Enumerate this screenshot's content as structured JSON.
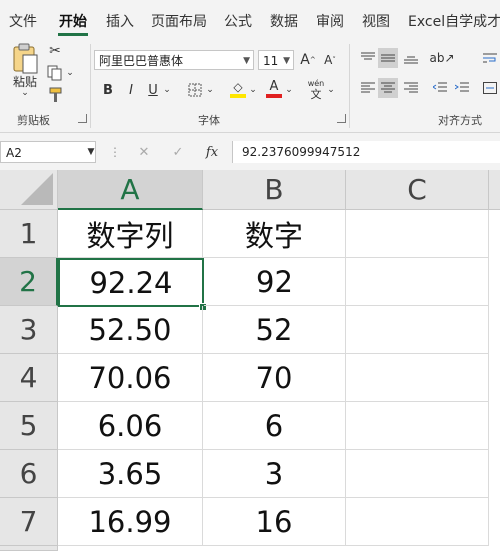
{
  "ribbon_tabs": [
    "文件",
    "开始",
    "插入",
    "页面布局",
    "公式",
    "数据",
    "审阅",
    "视图",
    "Excel自学成才"
  ],
  "active_tab": "开始",
  "clipboard": {
    "paste_label": "粘贴",
    "group_label": "剪贴板"
  },
  "font": {
    "family": "阿里巴巴普惠体",
    "size": "11",
    "group_label": "字体",
    "bold": "B",
    "italic": "I",
    "underline": "U",
    "grow": "A",
    "shrink": "A",
    "font_color_letter": "A",
    "phonetic_top": "wén",
    "phonetic_bottom": "文"
  },
  "alignment": {
    "group_label": "对齐方式"
  },
  "formula_bar": {
    "name_box": "A2",
    "cancel": "✕",
    "enter": "✓",
    "fx": "fx",
    "value": "92.2376099947512"
  },
  "sheet": {
    "columns": [
      "A",
      "B",
      "C"
    ],
    "selected_column": "A",
    "selected_row": "2",
    "rows": [
      {
        "num": "1",
        "a": "数字列",
        "b": "数字"
      },
      {
        "num": "2",
        "a": "92.24",
        "b": "92"
      },
      {
        "num": "3",
        "a": "52.50",
        "b": "52"
      },
      {
        "num": "4",
        "a": "70.06",
        "b": "70"
      },
      {
        "num": "5",
        "a": "6.06",
        "b": "6"
      },
      {
        "num": "6",
        "a": "3.65",
        "b": "3"
      },
      {
        "num": "7",
        "a": "16.99",
        "b": "16"
      }
    ]
  },
  "colors": {
    "accent": "#217346",
    "header_bg": "#e6e6e6",
    "selected_header_bg": "#d3d3d3",
    "font_color_bar": "#e02020",
    "highlight_bar": "#ffe600"
  }
}
